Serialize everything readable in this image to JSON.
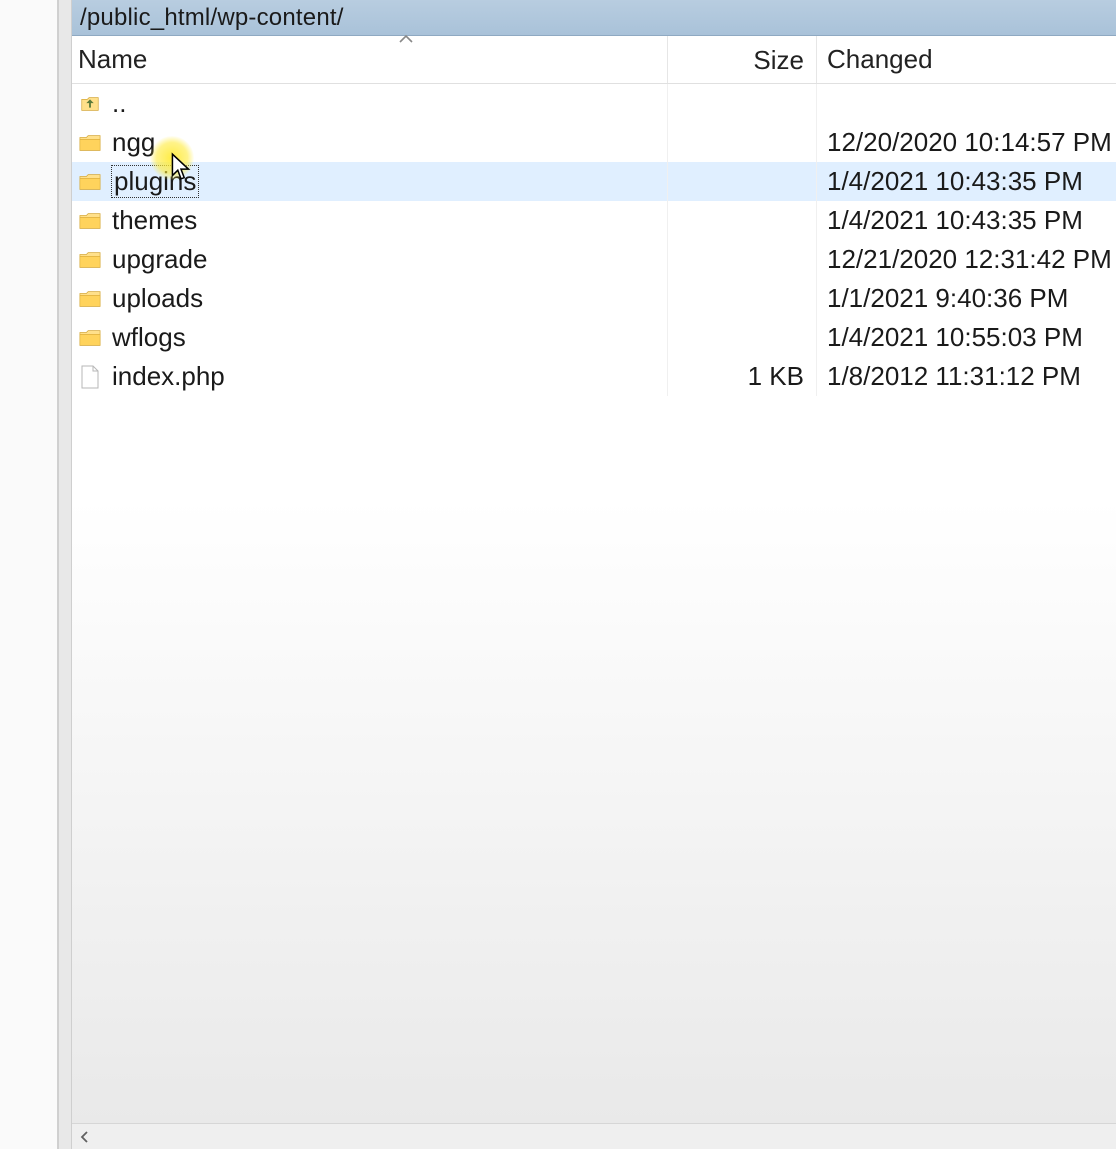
{
  "path": "/public_html/wp-content/",
  "columns": {
    "name": "Name",
    "size": "Size",
    "changed": "Changed"
  },
  "parent_label": "..",
  "rows": [
    {
      "type": "folder",
      "name": "ngg",
      "size": "",
      "changed": "12/20/2020 10:14:57 PM",
      "selected": false
    },
    {
      "type": "folder",
      "name": "plugins",
      "size": "",
      "changed": "1/4/2021 10:43:35 PM",
      "selected": true
    },
    {
      "type": "folder",
      "name": "themes",
      "size": "",
      "changed": "1/4/2021 10:43:35 PM",
      "selected": false
    },
    {
      "type": "folder",
      "name": "upgrade",
      "size": "",
      "changed": "12/21/2020 12:31:42 PM",
      "selected": false
    },
    {
      "type": "folder",
      "name": "uploads",
      "size": "",
      "changed": "1/1/2021 9:40:36 PM",
      "selected": false
    },
    {
      "type": "folder",
      "name": "wflogs",
      "size": "",
      "changed": "1/4/2021 10:55:03 PM",
      "selected": false
    },
    {
      "type": "file",
      "name": "index.php",
      "size": "1 KB",
      "changed": "1/8/2012 11:31:12 PM",
      "selected": false
    }
  ]
}
